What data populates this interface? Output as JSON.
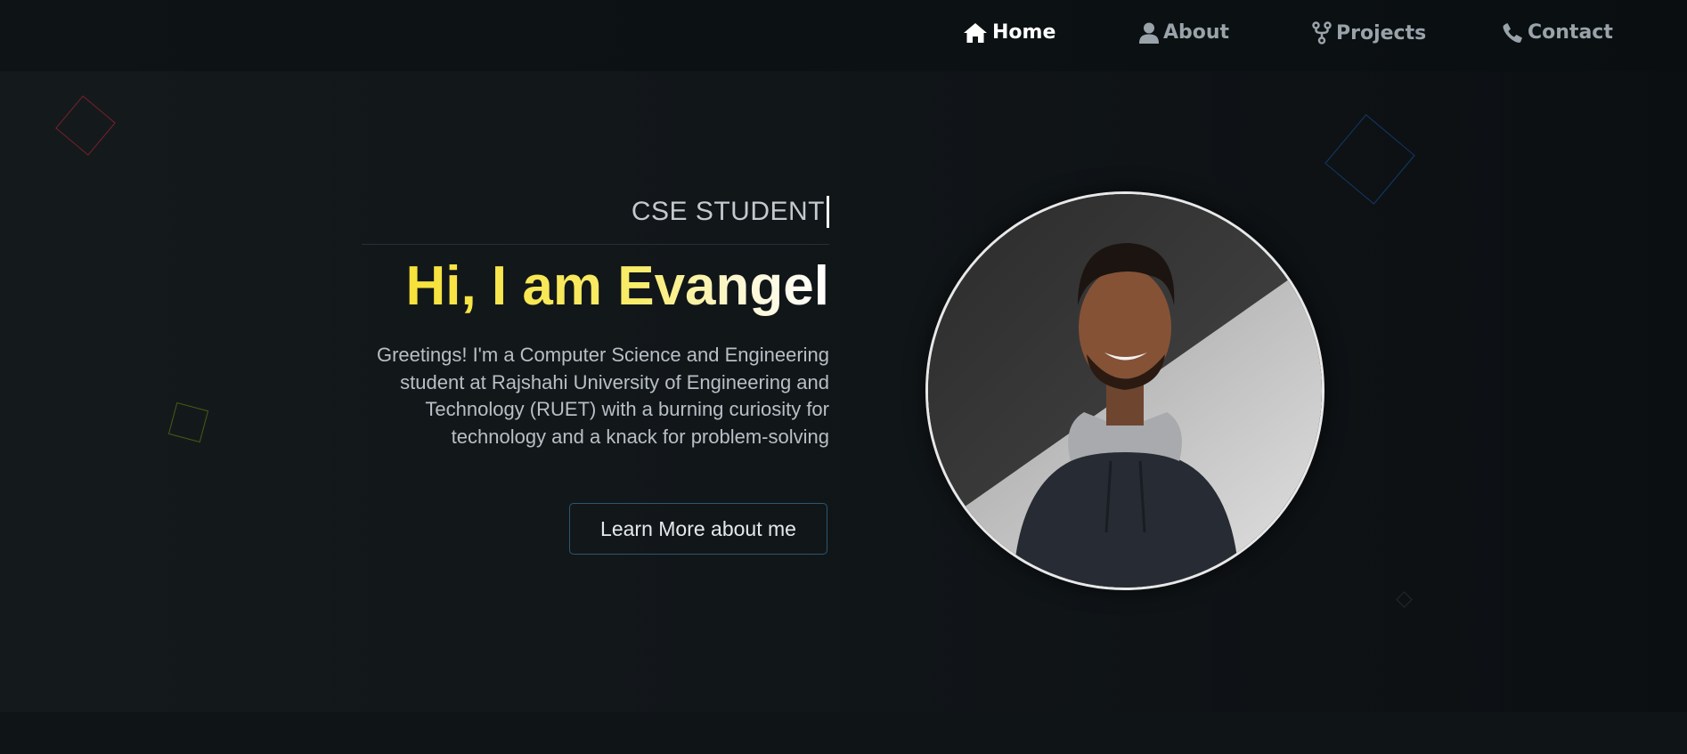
{
  "nav": {
    "items": [
      {
        "label": "Home",
        "icon": "home-icon",
        "active": true
      },
      {
        "label": "About",
        "icon": "user-icon",
        "active": false
      },
      {
        "label": "Projects",
        "icon": "fork-icon",
        "active": false
      },
      {
        "label": "Contact",
        "icon": "phone-icon",
        "active": false
      }
    ]
  },
  "hero": {
    "subtitle": "CSE STUDENT",
    "greeting": "Hi, I am Evangel",
    "intro": "Greetings! I'm a Computer Science and Engineering student at Rajshahi University of Engineering and Technology (RUET) with a burning curiosity for technology and a knack for problem-solving",
    "cta_label": "Learn More about me",
    "photo_icon": "profile-photo"
  },
  "colors": {
    "background": "#111619",
    "accent_yellow": "#f7e13a",
    "nav_active": "#ffffff",
    "nav_inactive": "#9aa3aa",
    "button_border": "#2c5670",
    "shape_red": "#7a1f2e",
    "shape_blue": "#103a66",
    "shape_olive": "#4a5a12"
  }
}
